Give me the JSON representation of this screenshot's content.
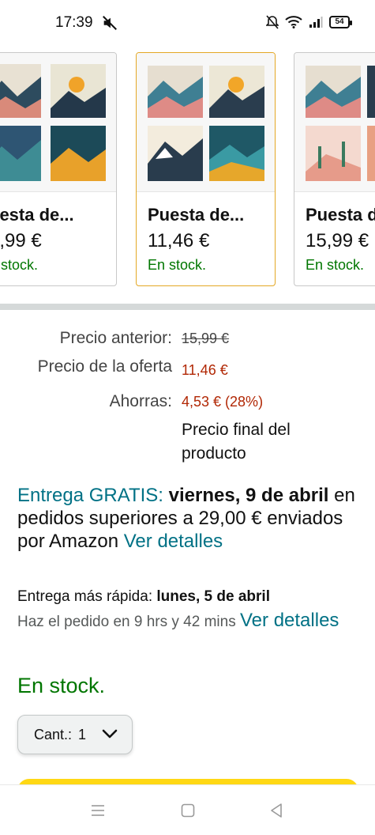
{
  "status_bar": {
    "time": "17:39",
    "battery": "54"
  },
  "carousel": {
    "items": [
      {
        "title": "uesta de...",
        "price": "5,99 €",
        "stock": "n stock."
      },
      {
        "title": "Puesta de...",
        "price": "11,46 €",
        "stock": "En stock."
      },
      {
        "title": "Puesta d",
        "price": "15,99 €",
        "stock": "En stock."
      }
    ]
  },
  "pricing": {
    "previous_label": "Precio anterior:",
    "previous_value": "15,99 €",
    "offer_label": "Precio de la oferta",
    "offer_value": "11,46 €",
    "savings_label": "Ahorras:",
    "savings_value": "4,53 € (28%)",
    "final_note_line1": "Precio final del",
    "final_note_line2": "producto"
  },
  "delivery": {
    "free_label": "Entrega GRATIS:",
    "date": "viernes, 9 de abril",
    "conditions": "en pedidos superiores a 29,00 € enviados por Amazon",
    "details_link": "Ver detalles"
  },
  "fast_delivery": {
    "label": "Entrega más rápida:",
    "date": "lunes, 5 de abril",
    "order_within": "Haz el pedido en 9 hrs y 42 mins",
    "details_link": "Ver detalles"
  },
  "availability": "En stock.",
  "quantity": {
    "label": "Cant.:",
    "value": "1"
  },
  "colors": {
    "teal": "#007185",
    "green": "#007600",
    "red": "#b12704",
    "selected_border": "#e4a825"
  }
}
